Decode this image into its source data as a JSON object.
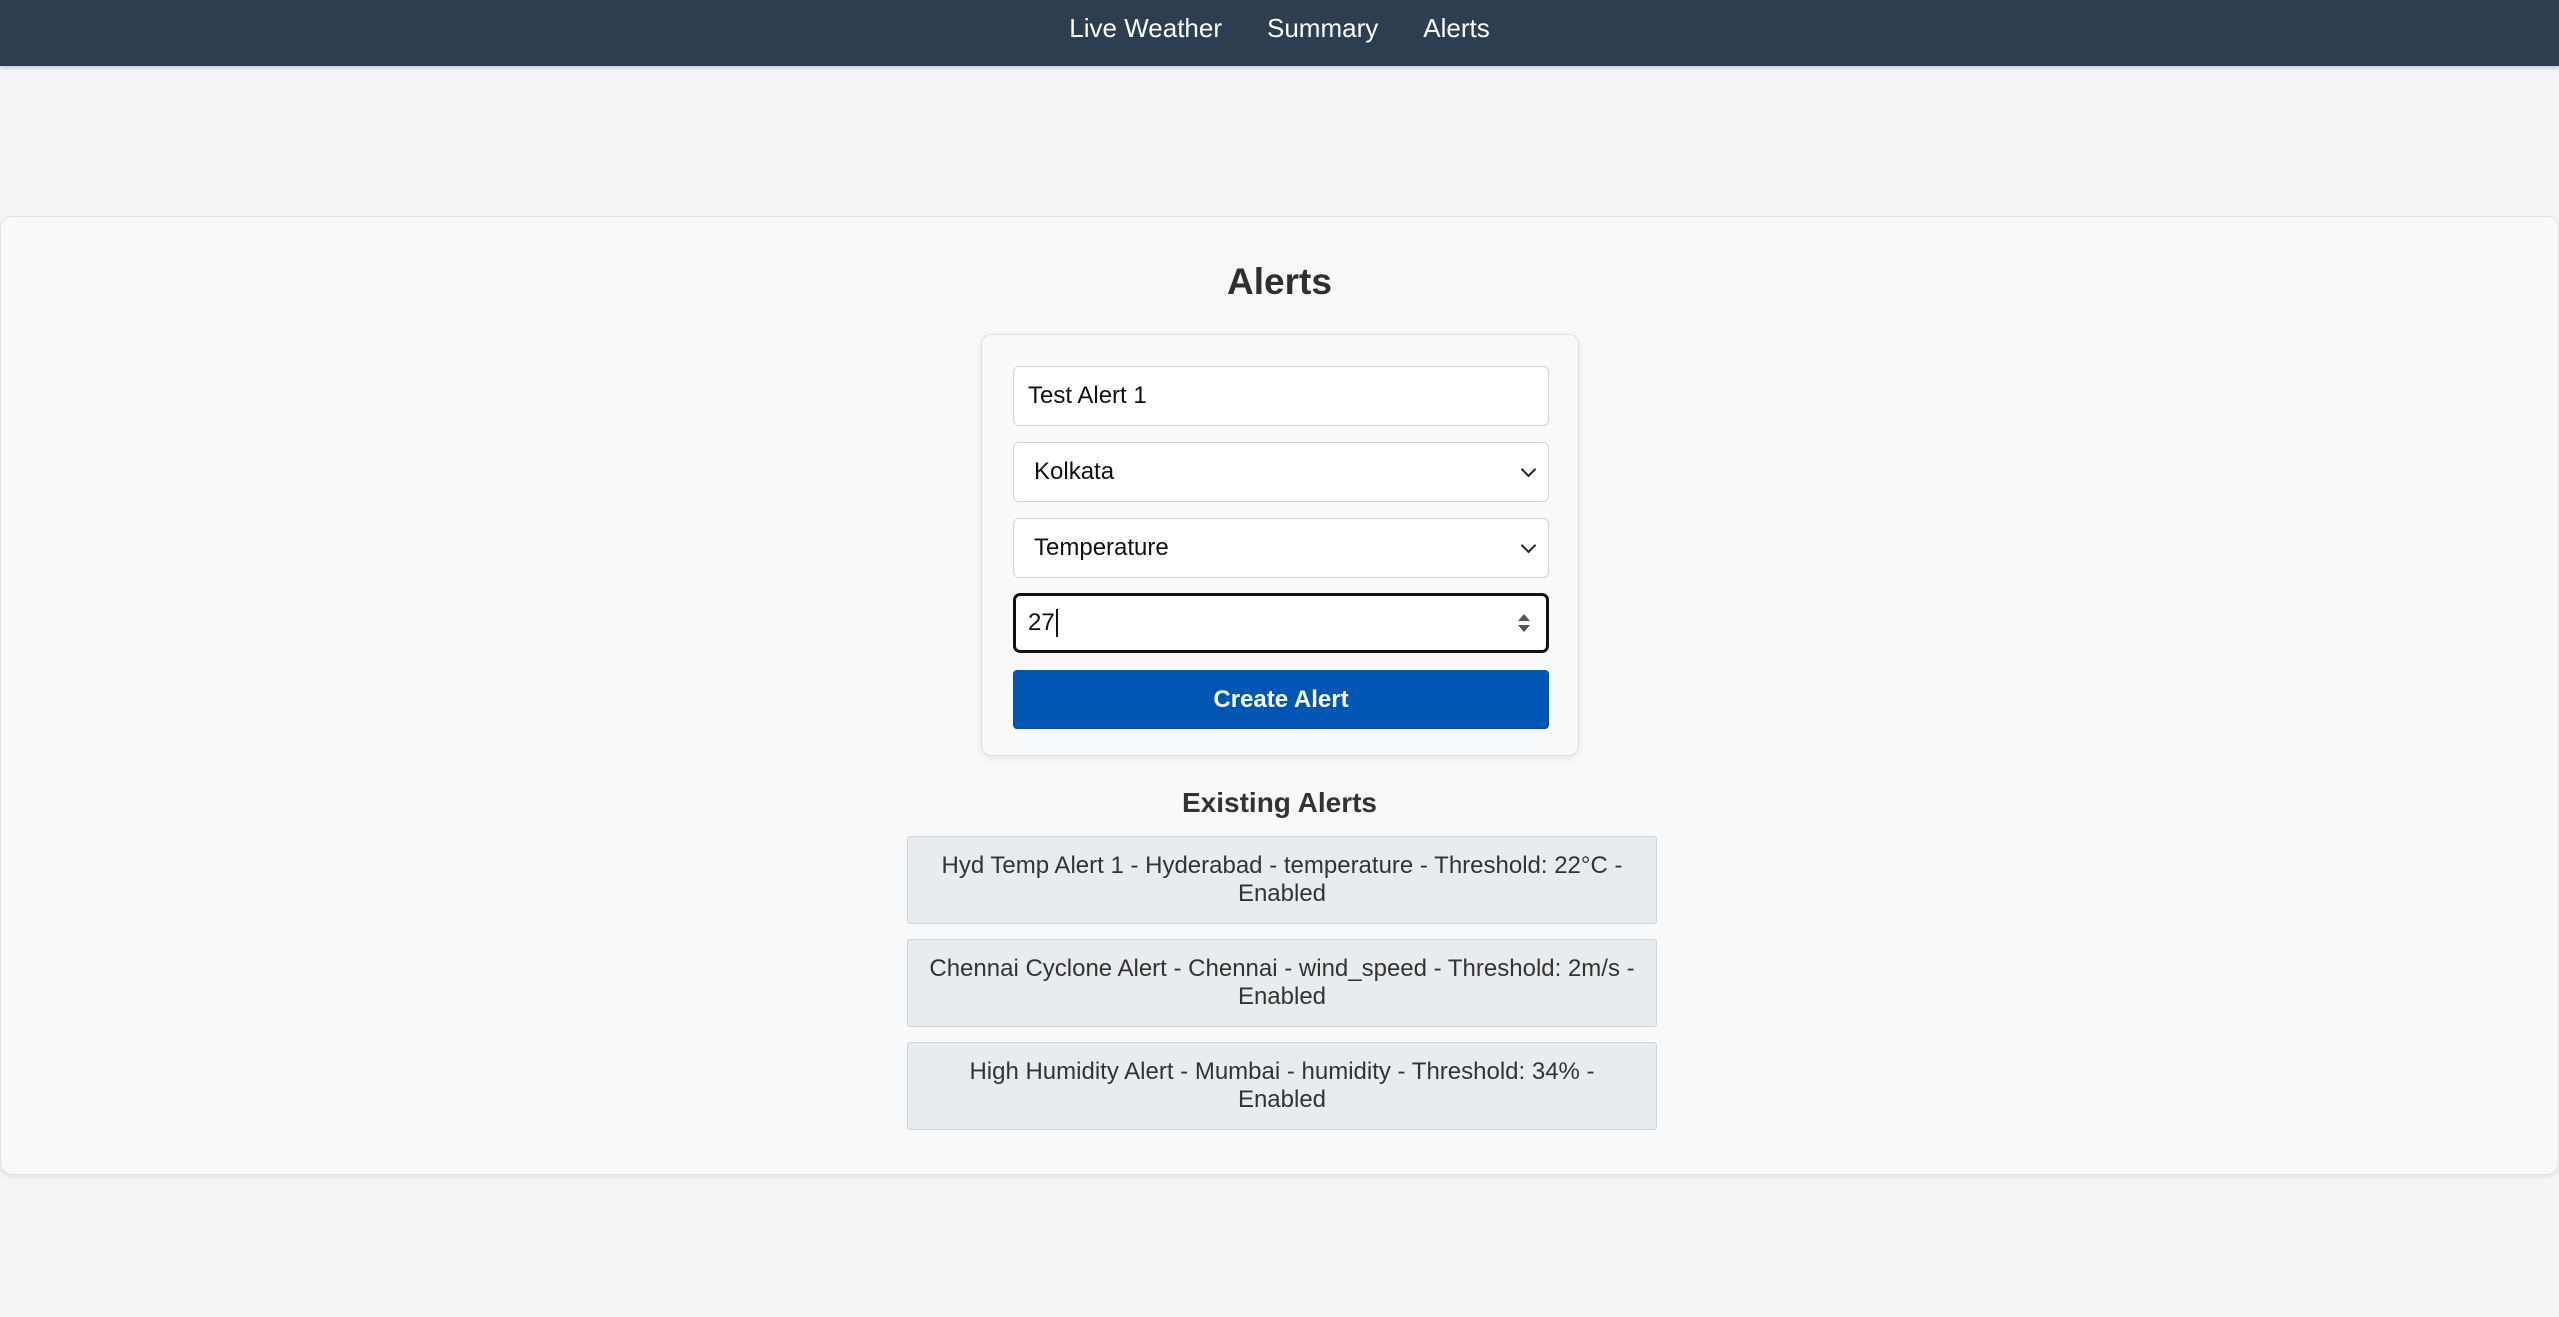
{
  "nav": {
    "items": [
      {
        "label": "Live Weather"
      },
      {
        "label": "Summary"
      },
      {
        "label": "Alerts"
      }
    ]
  },
  "page": {
    "title": "Alerts"
  },
  "form": {
    "alert_name_value": "Test Alert 1",
    "city_selected": "Kolkata",
    "parameter_selected": "Temperature",
    "threshold_value": "27",
    "submit_label": "Create Alert"
  },
  "existing": {
    "title": "Existing Alerts",
    "alerts": [
      {
        "text": "Hyd Temp Alert 1 - Hyderabad - temperature - Threshold: 22°C - Enabled"
      },
      {
        "text": "Chennai Cyclone Alert - Chennai - wind_speed - Threshold: 2m/s - Enabled"
      },
      {
        "text": "High Humidity Alert - Mumbai - humidity - Threshold: 34% - Enabled"
      }
    ]
  },
  "colors": {
    "navbar_bg": "#2d3e50",
    "primary_button": "#0056b3",
    "alert_item_bg": "#e9ecef",
    "page_bg": "#f3f5f7"
  },
  "icons": {
    "select_caret": "chevron-down-icon",
    "number_spinner": "spinner-arrows-icon"
  }
}
